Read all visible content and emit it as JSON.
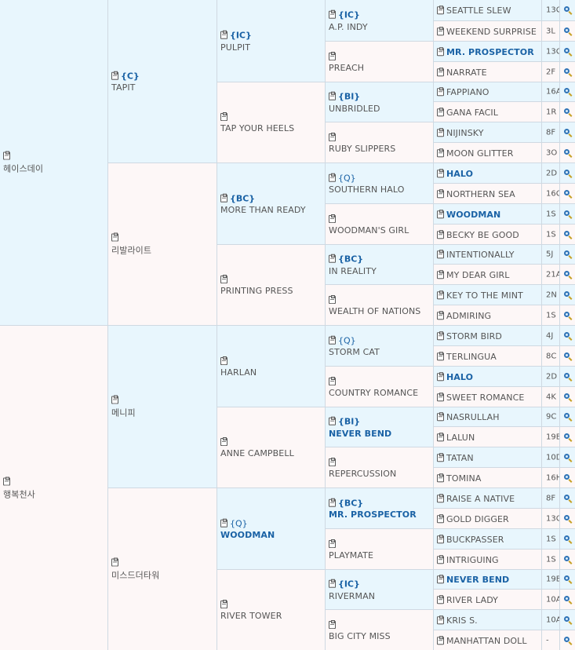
{
  "g0": [
    {
      "name": "헤이스데이",
      "tag": "",
      "hl": false
    },
    {
      "name": "행복천사",
      "tag": "",
      "hl": false
    }
  ],
  "g1": [
    {
      "name": "TAPIT",
      "tag": "{C}",
      "hl": false
    },
    {
      "name": "리발라이트",
      "tag": "",
      "hl": false
    },
    {
      "name": "메니피",
      "tag": "",
      "hl": false
    },
    {
      "name": "미스드더타워",
      "tag": "",
      "hl": false
    }
  ],
  "g2": [
    {
      "name": "PULPIT",
      "tag": "{IC}",
      "hl": false
    },
    {
      "name": "TAP YOUR HEELS",
      "tag": "",
      "hl": false
    },
    {
      "name": "MORE THAN READY",
      "tag": "{BC}",
      "hl": false
    },
    {
      "name": "PRINTING PRESS",
      "tag": "",
      "hl": false
    },
    {
      "name": "HARLAN",
      "tag": "",
      "hl": false
    },
    {
      "name": "ANNE CAMPBELL",
      "tag": "",
      "hl": false
    },
    {
      "name": "WOODMAN",
      "tag": "{Q}",
      "hl": true
    },
    {
      "name": "RIVER TOWER",
      "tag": "",
      "hl": false
    }
  ],
  "g3": [
    {
      "name": "A.P. INDY",
      "tag": "{IC}",
      "hl": false
    },
    {
      "name": "PREACH",
      "tag": "",
      "hl": false
    },
    {
      "name": "UNBRIDLED",
      "tag": "{BI}",
      "hl": false
    },
    {
      "name": "RUBY SLIPPERS",
      "tag": "",
      "hl": false
    },
    {
      "name": "SOUTHERN HALO",
      "tag": "{Q}",
      "hl": false
    },
    {
      "name": "WOODMAN'S GIRL",
      "tag": "",
      "hl": false
    },
    {
      "name": "IN REALITY",
      "tag": "{BC}",
      "hl": false
    },
    {
      "name": "WEALTH OF NATIONS",
      "tag": "",
      "hl": false
    },
    {
      "name": "STORM CAT",
      "tag": "{Q}",
      "hl": false
    },
    {
      "name": "COUNTRY ROMANCE",
      "tag": "",
      "hl": false
    },
    {
      "name": "NEVER BEND",
      "tag": "{BI}",
      "hl": true
    },
    {
      "name": "REPERCUSSION",
      "tag": "",
      "hl": false
    },
    {
      "name": "MR. PROSPECTOR",
      "tag": "{BC}",
      "hl": true
    },
    {
      "name": "PLAYMATE",
      "tag": "",
      "hl": false
    },
    {
      "name": "RIVERMAN",
      "tag": "{IC}",
      "hl": false
    },
    {
      "name": "BIG CITY MISS",
      "tag": "",
      "hl": false
    }
  ],
  "g4": [
    {
      "name": "SEATTLE SLEW",
      "hl": false,
      "code": "13C"
    },
    {
      "name": "WEEKEND SURPRISE",
      "hl": false,
      "code": "3L"
    },
    {
      "name": "MR. PROSPECTOR",
      "hl": true,
      "code": "13C"
    },
    {
      "name": "NARRATE",
      "hl": false,
      "code": "2F"
    },
    {
      "name": "FAPPIANO",
      "hl": false,
      "code": "16A"
    },
    {
      "name": "GANA FACIL",
      "hl": false,
      "code": "1R"
    },
    {
      "name": "NIJINSKY",
      "hl": false,
      "code": "8F"
    },
    {
      "name": "MOON GLITTER",
      "hl": false,
      "code": "3O"
    },
    {
      "name": "HALO",
      "hl": true,
      "code": "2D"
    },
    {
      "name": "NORTHERN SEA",
      "hl": false,
      "code": "16C"
    },
    {
      "name": "WOODMAN",
      "hl": true,
      "code": "1S"
    },
    {
      "name": "BECKY BE GOOD",
      "hl": false,
      "code": "1S"
    },
    {
      "name": "INTENTIONALLY",
      "hl": false,
      "code": "5J"
    },
    {
      "name": "MY DEAR GIRL",
      "hl": false,
      "code": "21A"
    },
    {
      "name": "KEY TO THE MINT",
      "hl": false,
      "code": "2N"
    },
    {
      "name": "ADMIRING",
      "hl": false,
      "code": "1S"
    },
    {
      "name": "STORM BIRD",
      "hl": false,
      "code": "4J"
    },
    {
      "name": "TERLINGUA",
      "hl": false,
      "code": "8C"
    },
    {
      "name": "HALO",
      "hl": true,
      "code": "2D"
    },
    {
      "name": "SWEET ROMANCE",
      "hl": false,
      "code": "4K"
    },
    {
      "name": "NASRULLAH",
      "hl": false,
      "code": "9C"
    },
    {
      "name": "LALUN",
      "hl": false,
      "code": "19B"
    },
    {
      "name": "TATAN",
      "hl": false,
      "code": "10D"
    },
    {
      "name": "TOMINA",
      "hl": false,
      "code": "16H"
    },
    {
      "name": "RAISE A NATIVE",
      "hl": false,
      "code": "8F"
    },
    {
      "name": "GOLD DIGGER",
      "hl": false,
      "code": "13C"
    },
    {
      "name": "BUCKPASSER",
      "hl": false,
      "code": "1S"
    },
    {
      "name": "INTRIGUING",
      "hl": false,
      "code": "1S"
    },
    {
      "name": "NEVER BEND",
      "hl": true,
      "code": "19B"
    },
    {
      "name": "RIVER LADY",
      "hl": false,
      "code": "10A"
    },
    {
      "name": "KRIS S.",
      "hl": false,
      "code": "10A"
    },
    {
      "name": "MANHATTAN DOLL",
      "hl": false,
      "code": "-"
    }
  ],
  "icons": {
    "doc": "clipboard-icon",
    "search": "magnifier-icon"
  },
  "colors": {
    "sire_bg": "#e8f6fd",
    "dam_bg": "#fdf7f7",
    "highlight": "#1a62a5"
  }
}
